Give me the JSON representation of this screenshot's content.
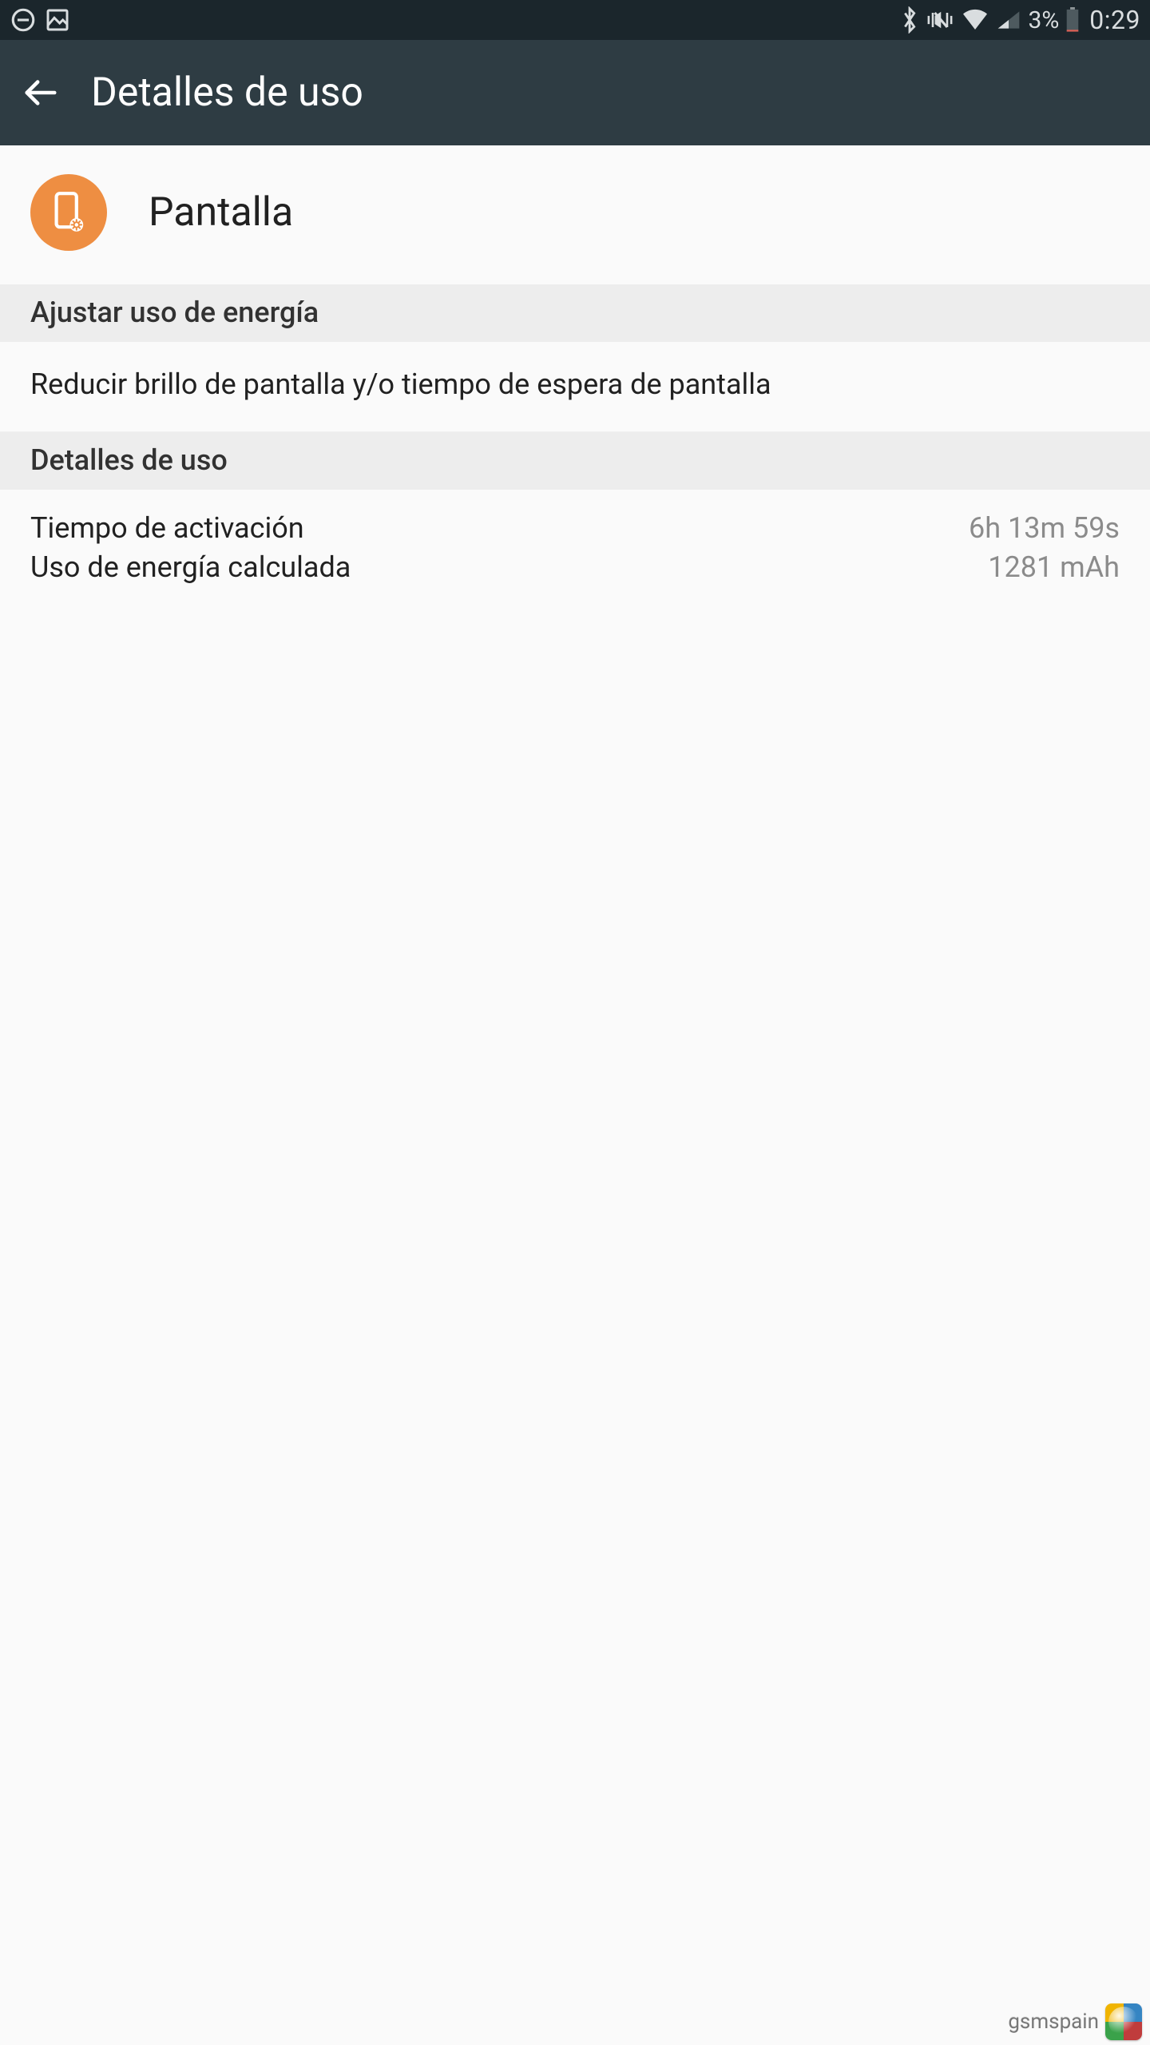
{
  "status": {
    "battery_pct": "3%",
    "time": "0:29"
  },
  "appbar": {
    "title": "Detalles de uso"
  },
  "header": {
    "app_name": "Pantalla"
  },
  "sections": {
    "adjust": {
      "header": "Ajustar uso de energía",
      "item_primary": "Reducir brillo de pantalla y/o tiempo de espera de pantalla"
    },
    "details": {
      "header": "Detalles de uso",
      "rows": [
        {
          "label": "Tiempo de activación",
          "value": "6h 13m 59s"
        },
        {
          "label": "Uso de energía calculada",
          "value": "1281 mAh"
        }
      ]
    }
  },
  "watermark": {
    "text": "gsmspain"
  },
  "colors": {
    "accent": "#ee8e42",
    "statusbar_bg": "#1b262c",
    "appbar_bg": "#2e3c43",
    "section_bg": "#ededed",
    "page_bg": "#fafafa",
    "text_primary": "#212121",
    "text_secondary": "#8b8b8b"
  }
}
